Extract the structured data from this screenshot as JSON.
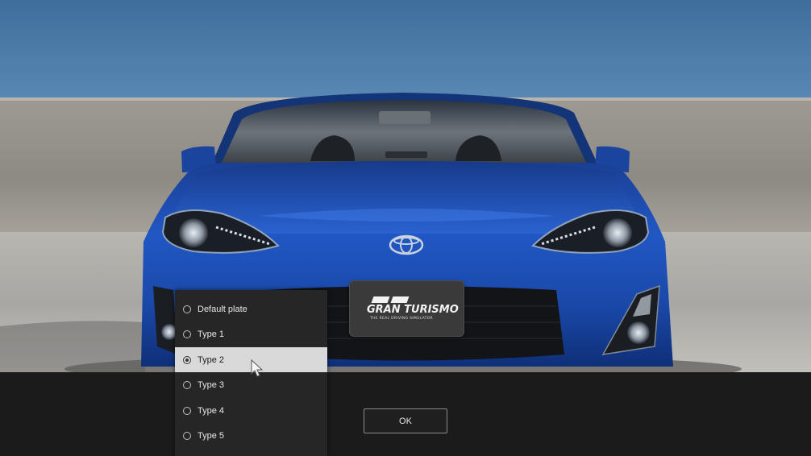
{
  "plate": {
    "title": "GRAN TURISMO",
    "subtitle": "THE REAL DRIVING SIMULATOR"
  },
  "plate_options": [
    {
      "label": "Default plate",
      "selected": false
    },
    {
      "label": "Type 1",
      "selected": false
    },
    {
      "label": "Type 2",
      "selected": true
    },
    {
      "label": "Type 3",
      "selected": false
    },
    {
      "label": "Type 4",
      "selected": false
    },
    {
      "label": "Type 5",
      "selected": false
    }
  ],
  "ok_button": {
    "label": "OK"
  },
  "colors": {
    "car_body": "#1d4fb8",
    "selected_option_bg": "#d9d9d9",
    "panel_bg": "#262626"
  }
}
